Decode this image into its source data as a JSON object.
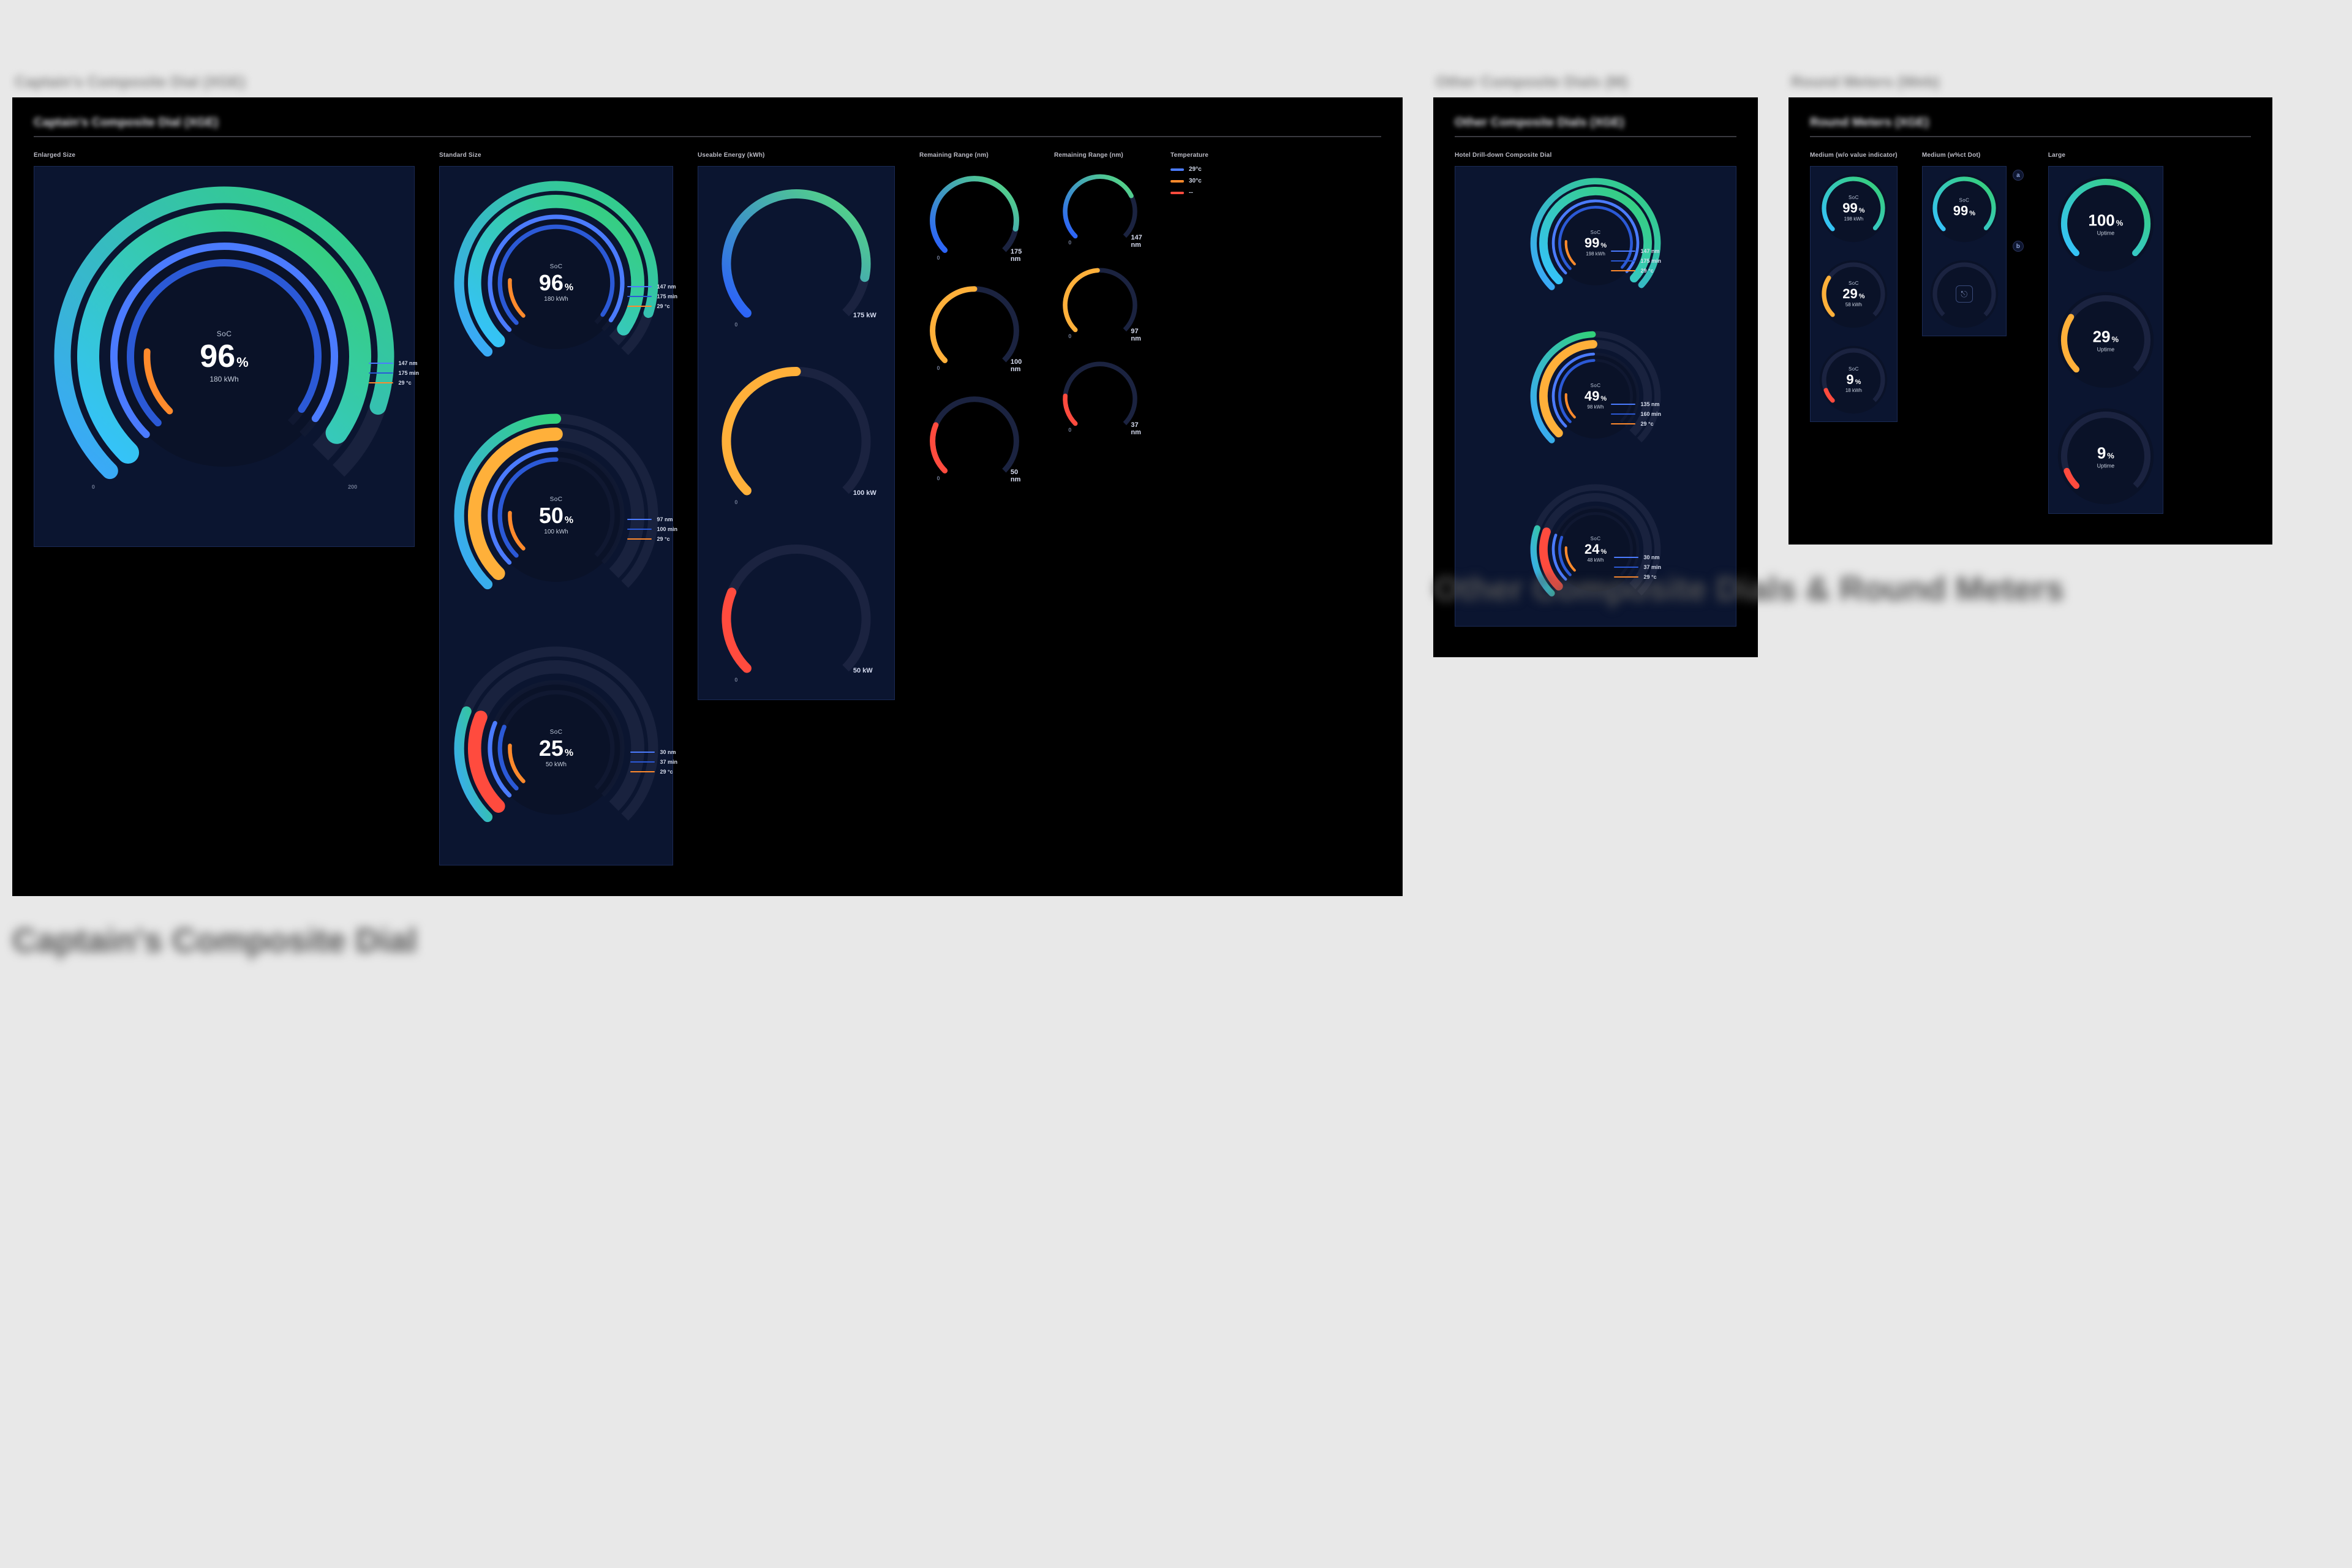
{
  "blurTitles": {
    "main": "Captain's Composite Dial (XGE)",
    "mid": "Other Composite Dials (M)",
    "right": "Round Meters (Web)"
  },
  "panelTitles": {
    "main": "Captain's Composite Dial (XGE)",
    "mid": "Other Composite Dials (XGE)",
    "right": "Round Meters (XGE)"
  },
  "captions": {
    "left": "Captain's Composite Dial",
    "right": "Other Composite Dials & Round Meters"
  },
  "mainCols": {
    "enlarged": "Enlarged Size",
    "standard": "Standard Size",
    "usable": "Useable Energy (kWh)",
    "range_lg": "Remaining Range (nm)",
    "range_sm": "Remaining Range (nm)",
    "temp": "Temperature"
  },
  "midCols": {
    "hotel": "Hotel Drill-down Composite Dial"
  },
  "rightCols": {
    "medium": "Medium (w/o value indicator)",
    "medium_wpct": "Medium (w%ct Dot)",
    "large": "Large"
  },
  "legend": {
    "a": "29°c",
    "b": "30°c",
    "c": "--"
  },
  "chart_data": {
    "captains_composite": {
      "enlarged": {
        "type": "composite_dial",
        "soc_label": "SoC",
        "soc_value": 96,
        "soc_unit": "%",
        "sub_value": "180 kWh",
        "outer_scale_ticks": [
          0,
          50,
          100,
          150,
          200
        ],
        "outer_scale_value": 180,
        "ring_soc_pct": 96,
        "range_nm": 147,
        "time_min": 175,
        "temp_c": 29,
        "kpis": [
          {
            "color": "blue",
            "n": "147",
            "u": "nm"
          },
          {
            "color": "blue2",
            "n": "175",
            "u": "min"
          },
          {
            "color": "orange",
            "n": "29",
            "u": "°c"
          }
        ],
        "tick_min_label": "0",
        "tick_max_label": "200"
      },
      "standard": [
        {
          "soc_label": "SoC",
          "soc_value": 96,
          "soc_unit": "%",
          "sub_value": "180 kWh",
          "outer_scale_value": 180,
          "ring_soc_pct": 96,
          "kpis": [
            {
              "color": "blue",
              "n": "147",
              "u": "nm"
            },
            {
              "color": "blue2",
              "n": "175",
              "u": "min"
            },
            {
              "color": "orange",
              "n": "29",
              "u": "°c"
            }
          ]
        },
        {
          "soc_label": "SoC",
          "soc_value": 50,
          "soc_unit": "%",
          "sub_value": "100 kWh",
          "outer_scale_value": 100,
          "ring_soc_pct": 50,
          "kpis": [
            {
              "color": "blue",
              "n": "97",
              "u": "nm"
            },
            {
              "color": "blue2",
              "n": "100",
              "u": "min"
            },
            {
              "color": "orange",
              "n": "29",
              "u": "°c"
            }
          ]
        },
        {
          "soc_label": "SoC",
          "soc_value": 25,
          "soc_unit": "%",
          "sub_value": "50 kWh",
          "outer_scale_value": 50,
          "ring_soc_pct": 25,
          "kpis": [
            {
              "color": "blue",
              "n": "30",
              "u": "nm"
            },
            {
              "color": "blue2",
              "n": "37",
              "u": "min"
            },
            {
              "color": "orange",
              "n": "29",
              "u": "°c"
            }
          ]
        }
      ]
    },
    "useable_energy_kwh": {
      "type": "arc_gauge",
      "scale": [
        0,
        200
      ],
      "samples": [
        {
          "value": 175,
          "label": "175 kW",
          "state": "high"
        },
        {
          "value": 100,
          "label": "100 kW",
          "state": "mid"
        },
        {
          "value": 50,
          "label": "50 kW",
          "state": "low"
        }
      ]
    },
    "remaining_range_nm_large": {
      "type": "arc_gauge",
      "scale": [
        0,
        200
      ],
      "samples": [
        {
          "value": 175,
          "label": "175 nm",
          "state": "high"
        },
        {
          "value": 100,
          "label": "100 nm",
          "state": "mid"
        },
        {
          "value": 50,
          "label": "50 nm",
          "state": "low"
        }
      ]
    },
    "remaining_range_nm_small": {
      "type": "arc_gauge",
      "scale": [
        0,
        200
      ],
      "samples": [
        {
          "value": 147,
          "label": "147 nm",
          "state": "high"
        },
        {
          "value": 97,
          "label": "97 nm",
          "state": "mid"
        },
        {
          "value": 37,
          "label": "37 nm",
          "state": "low"
        }
      ]
    },
    "hotel_drilldown": {
      "type": "composite_dial_small",
      "samples": [
        {
          "soc_label": "SoC",
          "soc_value": 99,
          "soc_unit": "%",
          "sub": "198 kWh",
          "kpis": [
            {
              "color": "blue",
              "n": "147",
              "u": "nm"
            },
            {
              "color": "blue2",
              "n": "175",
              "u": "min"
            },
            {
              "color": "orange",
              "n": "29",
              "u": "°c"
            }
          ]
        },
        {
          "soc_label": "SoC",
          "soc_value": 49,
          "soc_unit": "%",
          "sub": "98 kWh",
          "kpis": [
            {
              "color": "blue",
              "n": "135",
              "u": "nm"
            },
            {
              "color": "blue2",
              "n": "160",
              "u": "min"
            },
            {
              "color": "orange",
              "n": "29",
              "u": "°c"
            }
          ]
        },
        {
          "soc_label": "SoC",
          "soc_value": 24,
          "soc_unit": "%",
          "sub": "48 kWh",
          "kpis": [
            {
              "color": "blue",
              "n": "30",
              "u": "nm"
            },
            {
              "color": "blue2",
              "n": "37",
              "u": "min"
            },
            {
              "color": "orange",
              "n": "29",
              "u": "°c"
            }
          ]
        }
      ]
    },
    "round_meters": {
      "medium_no_value": [
        {
          "label": "SoC",
          "value": 99,
          "unit": "%",
          "sub": "198 kWh",
          "state": "high"
        },
        {
          "label": "SoC",
          "value": 29,
          "unit": "%",
          "sub": "58 kWh",
          "state": "mid"
        },
        {
          "label": "SoC",
          "value": 9,
          "unit": "%",
          "sub": "18 kWh",
          "state": "low"
        }
      ],
      "medium_w_dot": [
        {
          "label": "SoC",
          "value": 99,
          "unit": "%",
          "state": "high",
          "pill": "a"
        },
        {
          "center_icon": true,
          "pill": "b"
        }
      ],
      "large": [
        {
          "value": 100,
          "unit": "%",
          "sub": "Uptime",
          "state": "high"
        },
        {
          "value": 29,
          "unit": "%",
          "sub": "Uptime",
          "state": "mid"
        },
        {
          "value": 9,
          "unit": "%",
          "sub": "Uptime",
          "state": "low"
        }
      ]
    }
  },
  "colors": {
    "track": "#1b2340",
    "track2": "#121a33",
    "soc_high_a": "#36d06f",
    "soc_high_b": "#35c2ff",
    "soc_mid": "#ffb03a",
    "soc_low": "#ff4b3e",
    "kwh": "#3f7dff",
    "outer_high_a": "#32d27a",
    "outer_high_b": "#3aa7ff"
  }
}
